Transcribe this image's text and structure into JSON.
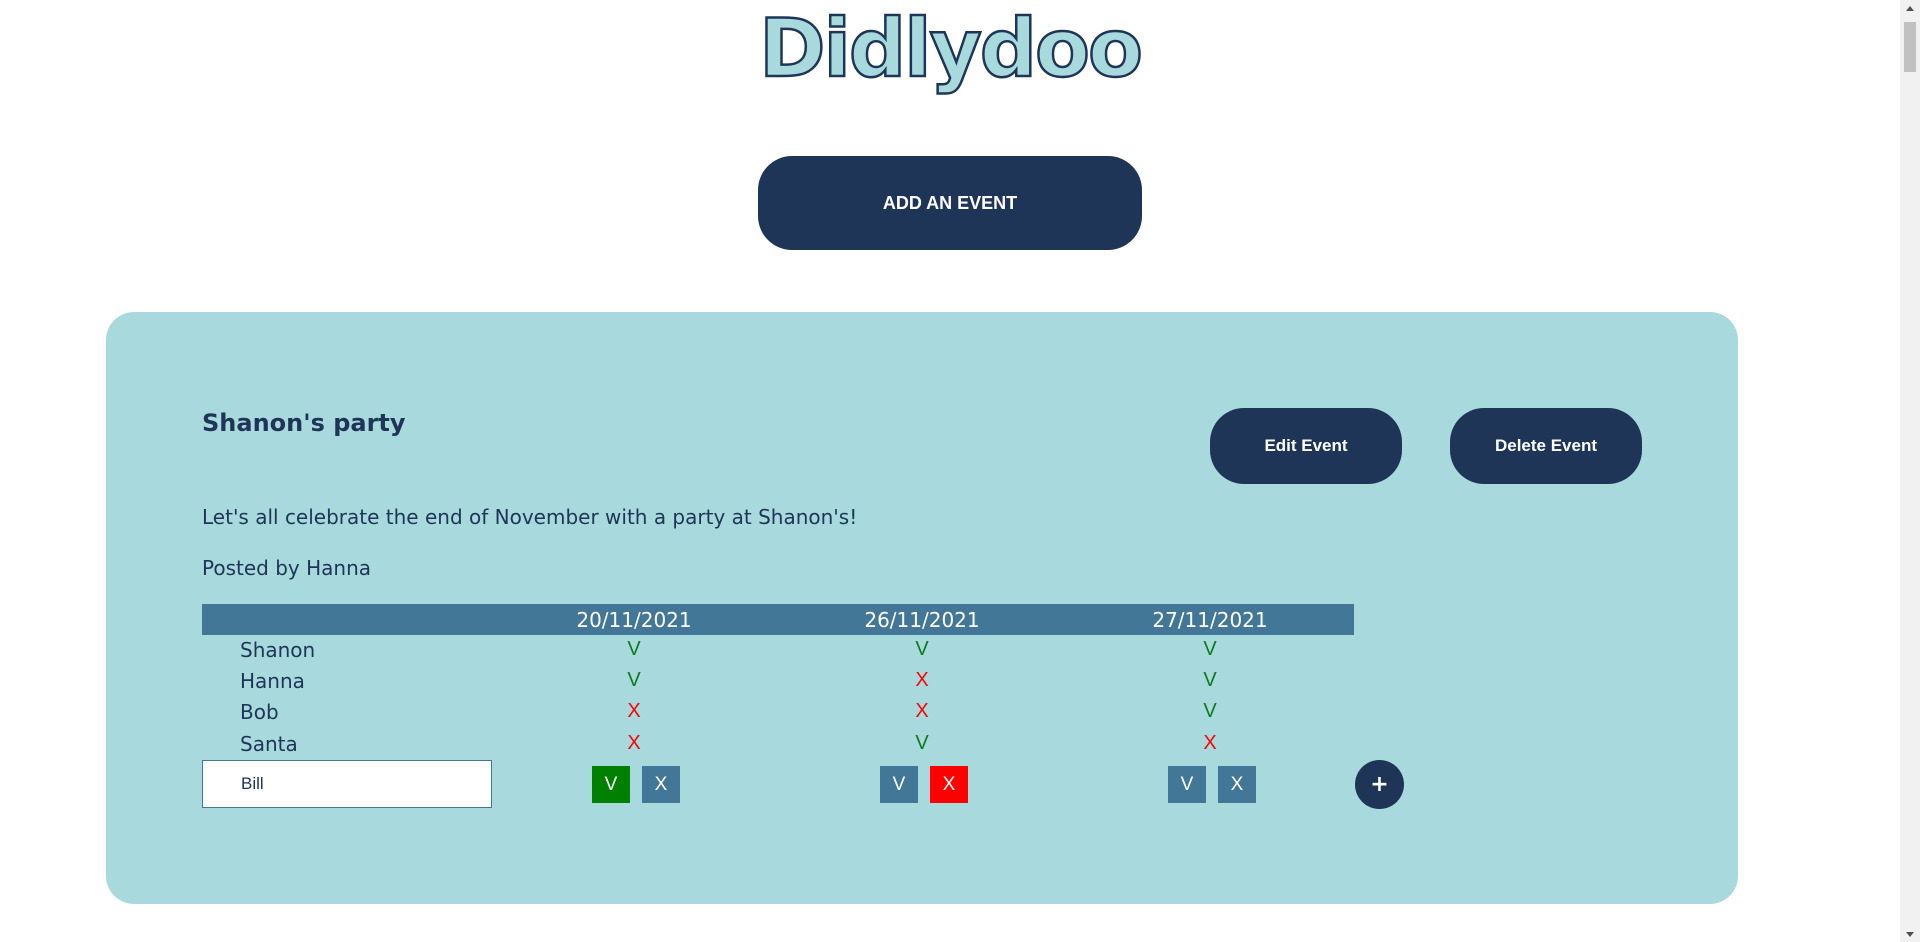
{
  "app": {
    "logo": "Didlydoo"
  },
  "actions": {
    "add_event": "ADD AN EVENT"
  },
  "event": {
    "title": "Shanon's party",
    "description": "Let's all celebrate the end of November with a party at Shanon's!",
    "posted_by": "Posted by Hanna",
    "edit_label": "Edit Event",
    "delete_label": "Delete Event",
    "dates": [
      "20/11/2021",
      "26/11/2021",
      "27/11/2021"
    ],
    "attendees": [
      {
        "name": "Shanon",
        "votes": [
          "V",
          "V",
          "V"
        ]
      },
      {
        "name": "Hanna",
        "votes": [
          "V",
          "X",
          "V"
        ]
      },
      {
        "name": "Bob",
        "votes": [
          "X",
          "X",
          "V"
        ]
      },
      {
        "name": "Santa",
        "votes": [
          "X",
          "V",
          "X"
        ]
      }
    ],
    "new_attendee": {
      "name_value": "Bill",
      "yes_label": "V",
      "no_label": "X",
      "selections": [
        "V",
        "X",
        null
      ]
    },
    "add_attendee_label": "+"
  },
  "colors": {
    "navy": "#1e3557",
    "card": "#a8d9dc",
    "header": "#437797",
    "yes": "#0f7a1c",
    "no": "#ff0000",
    "selected_yes": "#008000",
    "selected_no": "#ff0000"
  }
}
